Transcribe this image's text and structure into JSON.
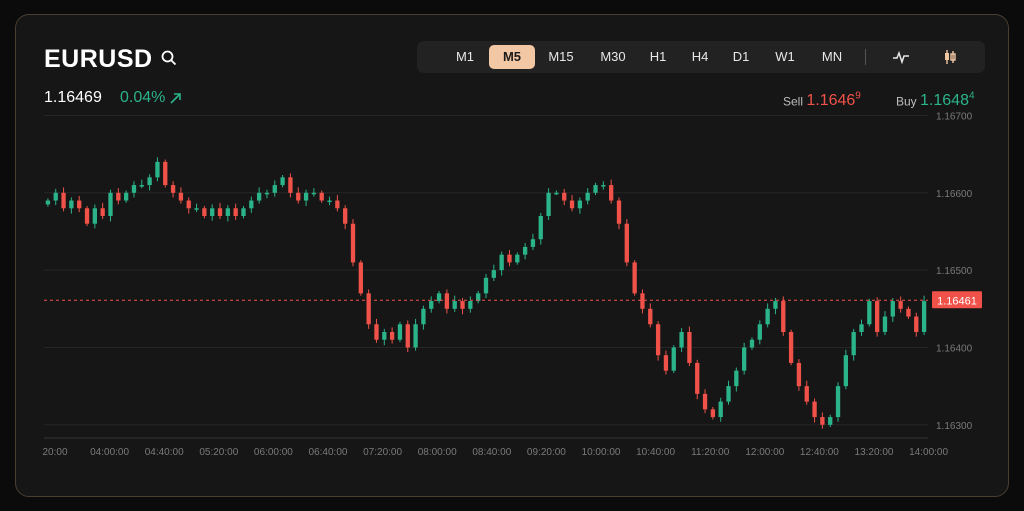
{
  "symbol": "EURUSD",
  "last_price": "1.16469",
  "change_pct": "0.04%",
  "timeframes": [
    "M1",
    "M5",
    "M15",
    "M30",
    "H1",
    "H4",
    "D1",
    "W1",
    "MN"
  ],
  "active_timeframe": "M5",
  "tools": [
    "line-chart-icon",
    "candlestick-icon"
  ],
  "sell": {
    "label": "Sell",
    "price_main": "1.1646",
    "price_sup": "9"
  },
  "buy": {
    "label": "Buy",
    "price_main": "1.1648",
    "price_sup": "4"
  },
  "colors": {
    "up": "#2bb38a",
    "down": "#f0524a",
    "accent": "#f2c7a4"
  },
  "chart_data": {
    "type": "candlestick",
    "current_price": 1.16461,
    "current_price_label": "1.16461",
    "ylim": [
      1.1627,
      1.1672
    ],
    "y_ticks": [
      "1.16700",
      "1.16600",
      "1.16500",
      "1.16400",
      "1.16300"
    ],
    "x_ticks": [
      "20:00",
      "04:00:00",
      "04:40:00",
      "05:20:00",
      "06:00:00",
      "06:40:00",
      "07:20:00",
      "08:00:00",
      "08:40:00",
      "09:20:00",
      "10:00:00",
      "10:40:00",
      "11:20:00",
      "12:00:00",
      "12:40:00",
      "13:20:00",
      "14:00:00"
    ],
    "close": [
      1.1659,
      1.166,
      1.1658,
      1.1659,
      1.1658,
      1.1656,
      1.1658,
      1.1657,
      1.166,
      1.1659,
      1.166,
      1.1661,
      1.1661,
      1.1662,
      1.1664,
      1.1661,
      1.166,
      1.1659,
      1.1658,
      1.1658,
      1.1657,
      1.1658,
      1.1657,
      1.1658,
      1.1657,
      1.1658,
      1.1659,
      1.166,
      1.166,
      1.1661,
      1.1662,
      1.166,
      1.1659,
      1.166,
      1.166,
      1.1659,
      1.1659,
      1.1658,
      1.1656,
      1.1651,
      1.1647,
      1.1643,
      1.1641,
      1.1642,
      1.1641,
      1.1643,
      1.164,
      1.1643,
      1.1645,
      1.1646,
      1.1647,
      1.1645,
      1.1646,
      1.1645,
      1.1646,
      1.1647,
      1.1649,
      1.165,
      1.1652,
      1.1651,
      1.1652,
      1.1653,
      1.1654,
      1.1657,
      1.166,
      1.166,
      1.1659,
      1.1658,
      1.1659,
      1.166,
      1.1661,
      1.1661,
      1.1659,
      1.1656,
      1.1651,
      1.1647,
      1.1645,
      1.1643,
      1.1639,
      1.1637,
      1.164,
      1.1642,
      1.1638,
      1.1634,
      1.1632,
      1.1631,
      1.1633,
      1.1635,
      1.1637,
      1.164,
      1.1641,
      1.1643,
      1.1645,
      1.1646,
      1.1642,
      1.1638,
      1.1635,
      1.1633,
      1.1631,
      1.163,
      1.1631,
      1.1635,
      1.1639,
      1.1642,
      1.1643,
      1.1646,
      1.1642,
      1.1644,
      1.1646,
      1.1645,
      1.1644,
      1.1642,
      1.1646
    ]
  }
}
